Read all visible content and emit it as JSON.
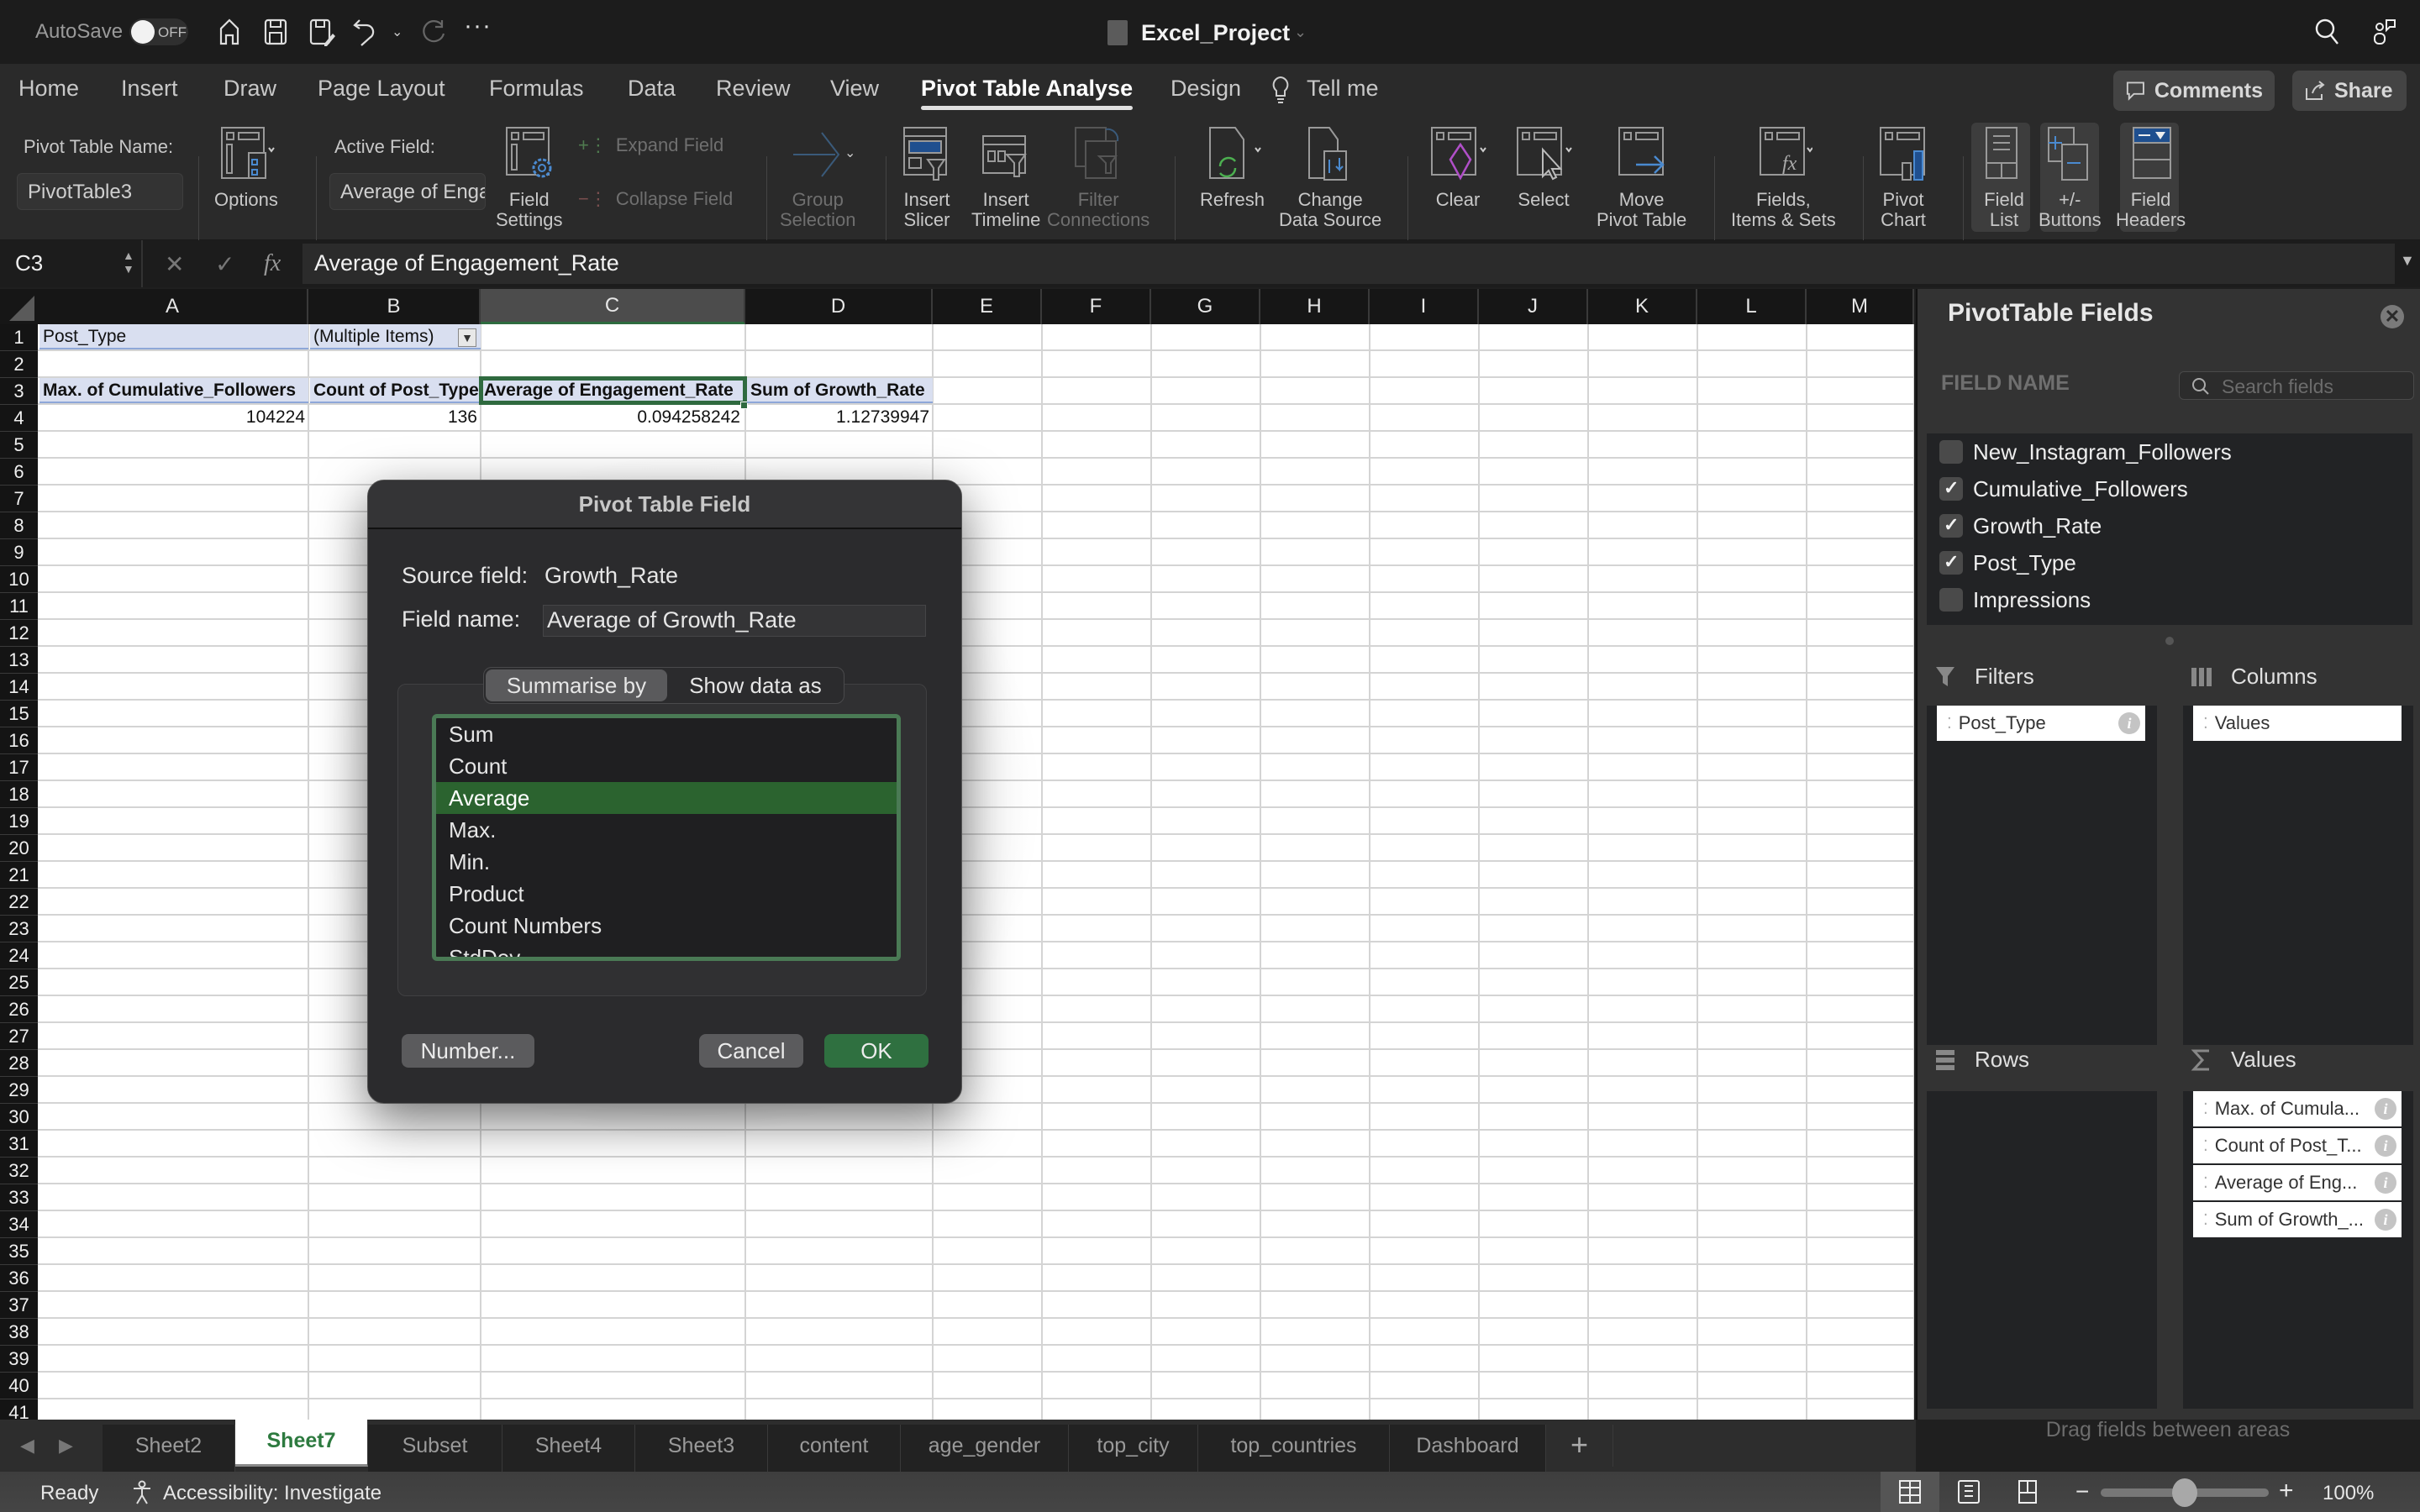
{
  "titlebar": {
    "autosave_label": "AutoSave",
    "autosave_state": "OFF",
    "doc_title": "Excel_Project",
    "quick_icons": [
      "home-icon",
      "save-icon",
      "save-as-icon",
      "undo-icon",
      "redo-icon",
      "more-icon"
    ]
  },
  "menu": {
    "tabs": [
      "Home",
      "Insert",
      "Draw",
      "Page Layout",
      "Formulas",
      "Data",
      "Review",
      "View",
      "Pivot Table Analyse",
      "Design",
      "Tell me"
    ],
    "active_tab": "Pivot Table Analyse",
    "comments_label": "Comments",
    "share_label": "Share"
  },
  "ribbon": {
    "pivot_name_label": "Pivot Table Name:",
    "pivot_name_value": "PivotTable3",
    "options_label": "Options",
    "active_field_label": "Active Field:",
    "active_field_value": "Average of Engagement_Rate",
    "field_settings_label": [
      "Field",
      "Settings"
    ],
    "expand_field_label": "Expand Field",
    "collapse_field_label": "Collapse Field",
    "group_selection_label": [
      "Group",
      "Selection"
    ],
    "insert_slicer_label": [
      "Insert",
      "Slicer"
    ],
    "insert_timeline_label": [
      "Insert",
      "Timeline"
    ],
    "filter_connections_label": [
      "Filter",
      "Connections"
    ],
    "refresh_label": "Refresh",
    "change_data_source_label": [
      "Change",
      "Data Source"
    ],
    "clear_label": "Clear",
    "select_label": "Select",
    "move_pivot_label": [
      "Move",
      "Pivot Table"
    ],
    "fields_items_sets_label": [
      "Fields,",
      "Items & Sets"
    ],
    "pivot_chart_label": [
      "Pivot",
      "Chart"
    ],
    "field_list_label": [
      "Field",
      "List"
    ],
    "buttons_label": [
      "+/-",
      "Buttons"
    ],
    "field_headers_label": [
      "Field",
      "Headers"
    ]
  },
  "formula_bar": {
    "name_box": "C3",
    "fx_label": "fx",
    "formula": "Average of Engagement_Rate"
  },
  "grid": {
    "columns": [
      "A",
      "B",
      "C",
      "D",
      "E",
      "F",
      "G",
      "H",
      "I",
      "J",
      "K",
      "L",
      "M"
    ],
    "selected_column": "C",
    "rows": [
      "1",
      "2",
      "3",
      "4",
      "5",
      "6",
      "7",
      "8",
      "9",
      "10",
      "11",
      "12",
      "13",
      "14",
      "15",
      "16",
      "17",
      "18",
      "19",
      "20",
      "21",
      "22",
      "23",
      "24",
      "25",
      "26",
      "27",
      "28",
      "29",
      "30",
      "31",
      "32",
      "33",
      "34",
      "35",
      "36",
      "37",
      "38",
      "39",
      "40",
      "41"
    ],
    "cells": {
      "A1": "Post_Type",
      "B1": "(Multiple Items)",
      "A3": "Max. of Cumulative_Followers",
      "B3": "Count of Post_Type",
      "C3": "Average of Engagement_Rate",
      "D3": "Sum of Growth_Rate",
      "A4": "104224",
      "B4": "136",
      "C4": "0.094258242",
      "D4": "1.12739947"
    },
    "active_cell": "C3"
  },
  "dialog": {
    "title": "Pivot Table Field",
    "source_field_label": "Source field:",
    "source_field_value": "Growth_Rate",
    "field_name_label": "Field name:",
    "field_name_value": "Average of Growth_Rate",
    "tabs": [
      "Summarise by",
      "Show data as"
    ],
    "active_tab": "Summarise by",
    "functions": [
      "Sum",
      "Count",
      "Average",
      "Max.",
      "Min.",
      "Product",
      "Count Numbers",
      "StdDev"
    ],
    "selected_function": "Average",
    "number_button": "Number...",
    "cancel_button": "Cancel",
    "ok_button": "OK"
  },
  "panel": {
    "title": "PivotTable Fields",
    "field_name_header": "FIELD NAME",
    "search_placeholder": "Search fields",
    "fields": [
      {
        "name": "New_Instagram_Followers",
        "checked": false
      },
      {
        "name": "Cumulative_Followers",
        "checked": true
      },
      {
        "name": "Growth_Rate",
        "checked": true
      },
      {
        "name": "Post_Type",
        "checked": true
      },
      {
        "name": "Impressions",
        "checked": false
      }
    ],
    "filters_label": "Filters",
    "columns_label": "Columns",
    "rows_label": "Rows",
    "values_label": "Values",
    "filters_items": [
      "Post_Type"
    ],
    "columns_items": [
      "Values"
    ],
    "rows_items": [],
    "values_items": [
      "Max. of Cumula...",
      "Count of Post_T...",
      "Average of Eng...",
      "Sum of Growth_..."
    ],
    "drag_hint": "Drag fields between areas"
  },
  "sheets": {
    "tabs": [
      "Sheet2",
      "Sheet7",
      "Subset",
      "Sheet4",
      "Sheet3",
      "content",
      "age_gender",
      "top_city",
      "top_countries",
      "Dashboard"
    ],
    "active": "Sheet7",
    "add_label": "+"
  },
  "status": {
    "ready": "Ready",
    "accessibility": "Accessibility: Investigate",
    "zoom_level": "100%",
    "zoom_fraction": 0.5,
    "view_mode": "normal"
  },
  "colors": {
    "accent_green": "#2f6a3f",
    "pivot_header_fill": "#d9dff0",
    "selected_list_green": "#2b632f"
  }
}
